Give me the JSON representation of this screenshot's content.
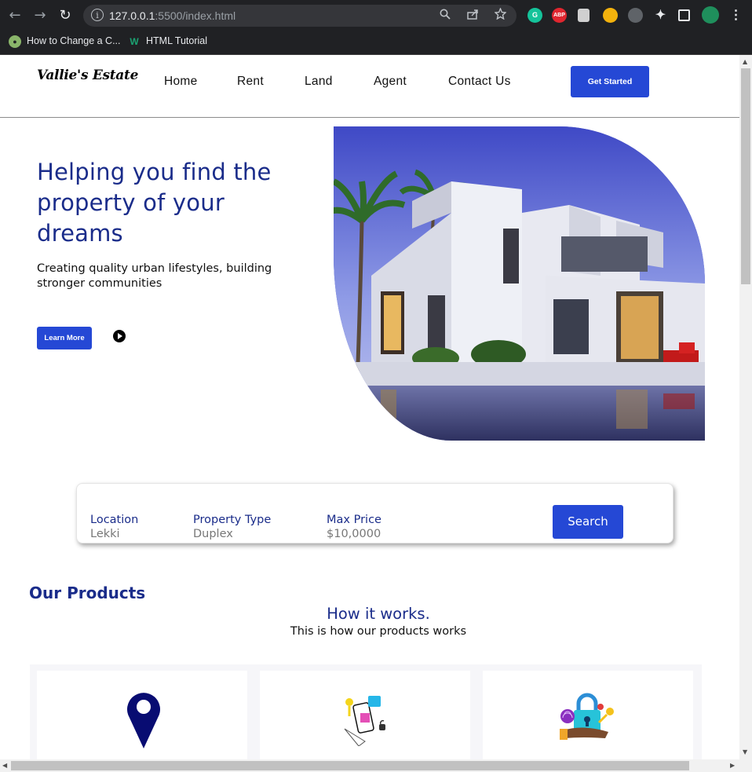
{
  "browser": {
    "url_host": "127.0.0.1",
    "url_rest": ":5500/index.html",
    "bookmarks": [
      {
        "label": "How to Change a C..."
      },
      {
        "label": "HTML Tutorial"
      }
    ],
    "extensions": [
      "G",
      "ABP"
    ]
  },
  "site": {
    "logo": "Vallie's Estate",
    "nav": [
      "Home",
      "Rent",
      "Land",
      "Agent",
      "Contact Us"
    ],
    "cta": "Get Started"
  },
  "hero": {
    "title": "Helping you find the property of your dreams",
    "subtitle": "Creating quality urban lifestyles, building stronger communities",
    "learn_more": "Learn More"
  },
  "search": {
    "fields": [
      {
        "label": "Location",
        "value": "Lekki"
      },
      {
        "label": "Property Type",
        "value": "Duplex"
      },
      {
        "label": "Max Price",
        "value": "$10,0000"
      }
    ],
    "button": "Search"
  },
  "products": {
    "section_title": "Our Products",
    "how_title": "How it works.",
    "how_sub": "This is how our products works",
    "cards": [
      {
        "icon": "location-pin-icon"
      },
      {
        "icon": "smart-lock-phone-icon"
      },
      {
        "icon": "security-padlock-icon"
      }
    ]
  },
  "colors": {
    "brand_blue": "#2548d5",
    "heading_navy": "#1a2c8a"
  }
}
